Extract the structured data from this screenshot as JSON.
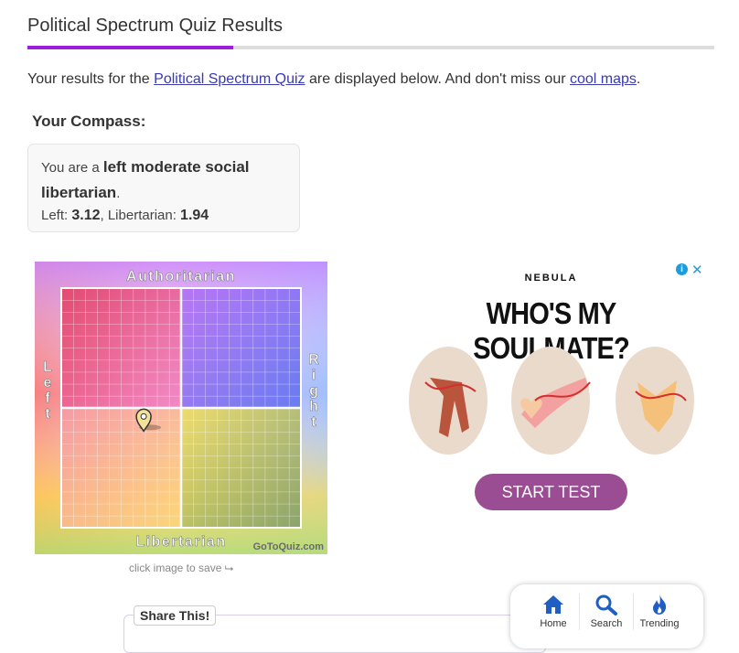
{
  "header": {
    "title": "Political Spectrum Quiz Results"
  },
  "intro": {
    "prefix": "Your results for the ",
    "quiz_link": "Political Spectrum Quiz",
    "middle": " are displayed below. And don't miss our ",
    "maps_link": "cool maps",
    "suffix": "."
  },
  "compass_heading": "Your Compass:",
  "result": {
    "you_are": "You are a ",
    "label": "left moderate social libertarian",
    "period": ".",
    "left_label": "Left: ",
    "left_value": "3.12",
    "libertarian_label": ", Libertarian: ",
    "libertarian_value": "1.94"
  },
  "compass": {
    "top_label": "Authoritarian",
    "bottom_label": "Libertarian",
    "left_label": "Left",
    "right_label": "Right",
    "watermark": "GoToQuiz.com",
    "marker": {
      "economic": -3.12,
      "social": -1.94
    }
  },
  "save_hint": "click image to save ⮡",
  "ad": {
    "brand": "NEBULA",
    "headline": "WHO'S MY SOULMATE?",
    "cta": "START TEST",
    "info_icon": "info-icon",
    "close_icon": "close-icon"
  },
  "share": {
    "label": "Share This!"
  },
  "bottom_nav": {
    "items": [
      {
        "label": "Home",
        "icon": "home-icon"
      },
      {
        "label": "Search",
        "icon": "search-icon"
      },
      {
        "label": "Trending",
        "icon": "flame-icon"
      }
    ]
  }
}
